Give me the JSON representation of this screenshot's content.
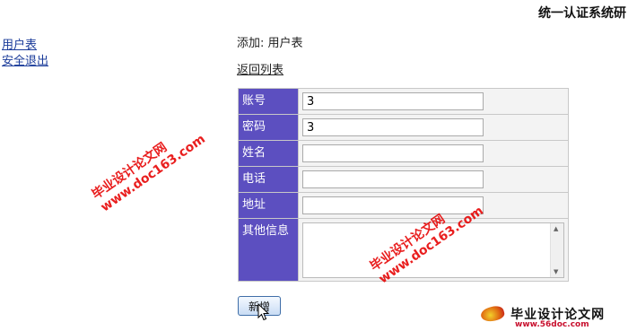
{
  "header": {
    "app_title": "统一认证系统研"
  },
  "sidebar": {
    "items": [
      {
        "label": "用户表"
      },
      {
        "label": "安全退出"
      }
    ]
  },
  "main": {
    "heading": "添加: 用户表",
    "back_link": "返回列表",
    "fields": [
      {
        "label": "账号",
        "value": "3"
      },
      {
        "label": "密码",
        "value": "3"
      },
      {
        "label": "姓名",
        "value": ""
      },
      {
        "label": "电话",
        "value": ""
      },
      {
        "label": "地址",
        "value": ""
      },
      {
        "label": "其他信息",
        "value": ""
      }
    ],
    "submit_label": "新增"
  },
  "watermark": {
    "line1": "毕业设计论文网",
    "line2": "www.doc163.com",
    "logo_title": "毕业设计论文网",
    "logo_url": "www.56doc.com"
  },
  "colors": {
    "label_bg": "#5c4fc0",
    "link": "#1a3b9a",
    "watermark": "#e60000"
  }
}
